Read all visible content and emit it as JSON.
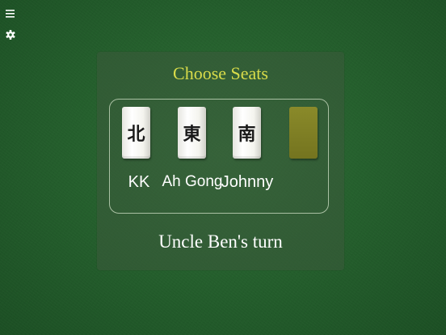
{
  "toolbar": {
    "menu_icon": "hamburger-menu-icon",
    "settings_icon": "gear-icon"
  },
  "dialog": {
    "title": "Choose Seats",
    "turn_text": "Uncle Ben's turn",
    "seats": [
      {
        "tile": "北",
        "name": "KK",
        "state": "taken"
      },
      {
        "tile": "東",
        "name": "Ah Gong",
        "state": "taken"
      },
      {
        "tile": "南",
        "name": "Johnny",
        "state": "taken"
      },
      {
        "tile": "",
        "name": "",
        "state": "face-down"
      }
    ]
  },
  "colors": {
    "felt": "#25602d",
    "title": "#d9dc4a",
    "tile_back": "#7f7f25",
    "text": "#ffffff"
  }
}
